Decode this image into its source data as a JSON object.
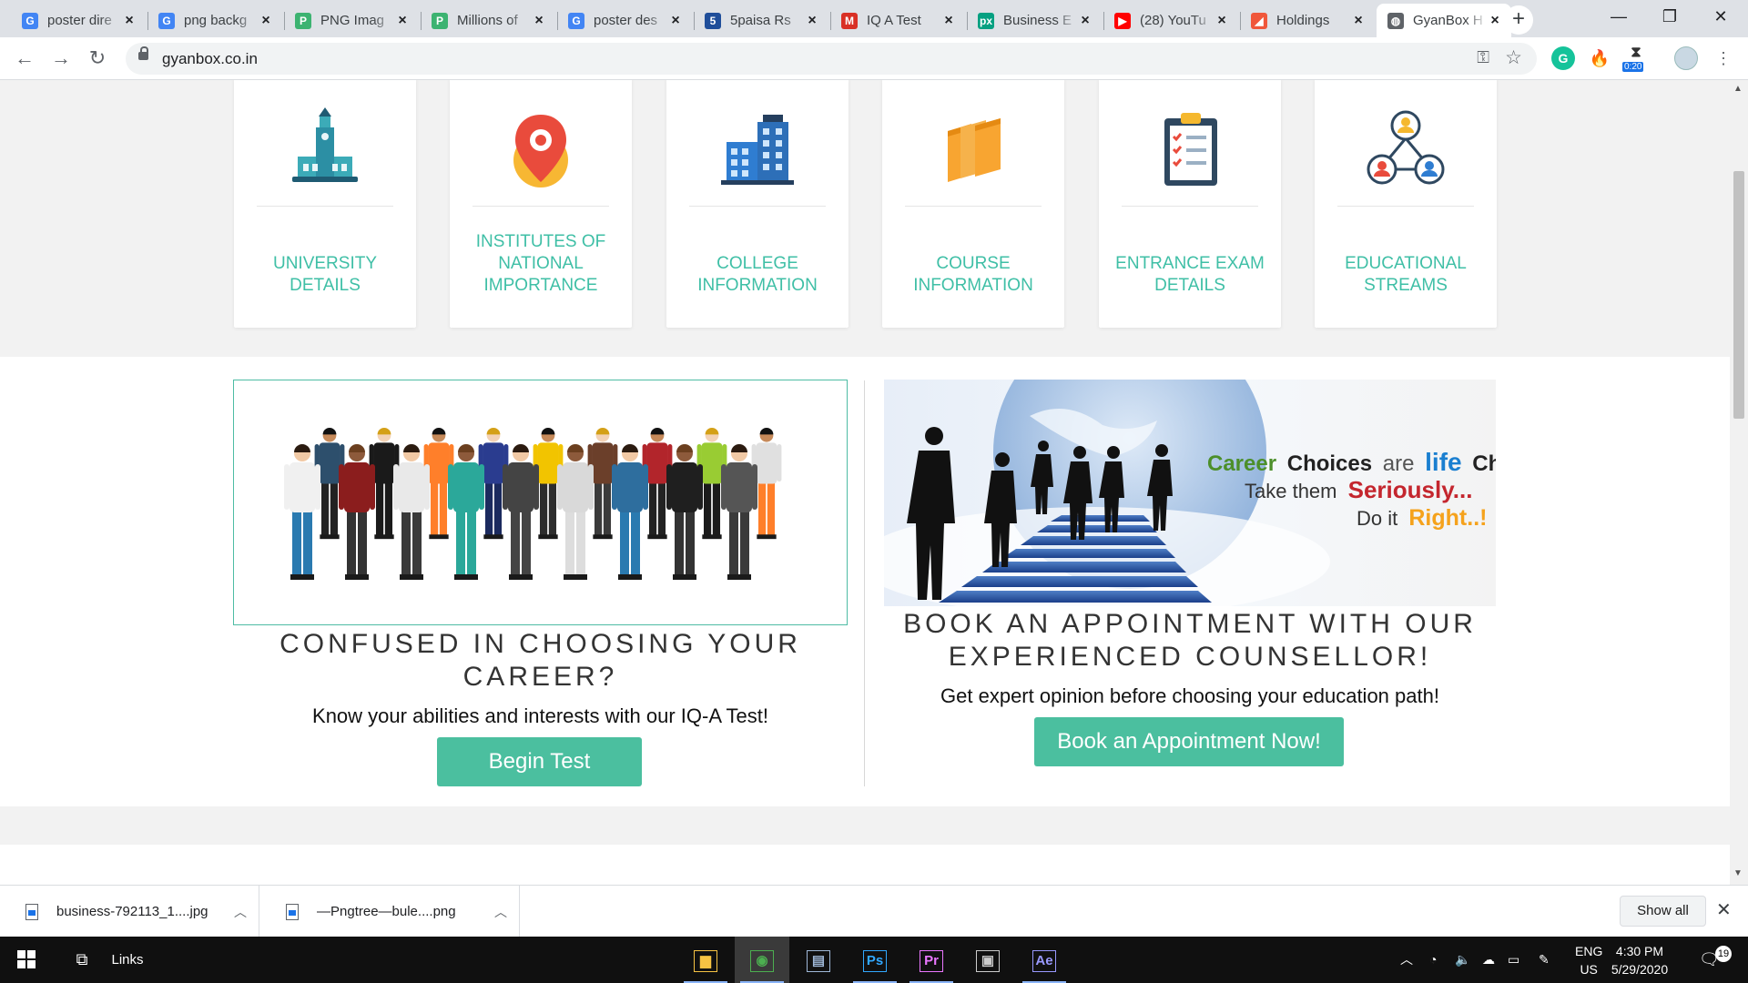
{
  "browser": {
    "tabs": [
      {
        "title": "poster dire",
        "favicon": "google-icon",
        "color": "#4285f4",
        "glyph": "G"
      },
      {
        "title": "png backg",
        "favicon": "google-icon",
        "color": "#4285f4",
        "glyph": "G"
      },
      {
        "title": "PNG Imag",
        "favicon": "pngtree-icon",
        "color": "#3cb371",
        "glyph": "P"
      },
      {
        "title": "Millions of",
        "favicon": "pngtree-icon",
        "color": "#3cb371",
        "glyph": "P"
      },
      {
        "title": "poster des",
        "favicon": "google-icon",
        "color": "#4285f4",
        "glyph": "G"
      },
      {
        "title": "5paisa Rs",
        "favicon": "5paisa-icon",
        "color": "#1f4e9a",
        "glyph": "5"
      },
      {
        "title": "IQ A Test",
        "favicon": "gmail-icon",
        "color": "#d93025",
        "glyph": "M"
      },
      {
        "title": "Business E",
        "favicon": "pexels-icon",
        "color": "#05a081",
        "glyph": "px"
      },
      {
        "title": "(28) YouTu",
        "favicon": "youtube-icon",
        "color": "#ff0000",
        "glyph": "▶"
      },
      {
        "title": "Holdings",
        "favicon": "zerodha-icon",
        "color": "#f0573b",
        "glyph": "◢"
      },
      {
        "title": "GyanBox H",
        "favicon": "globe-icon",
        "color": "#5f6368",
        "glyph": "◍",
        "active": true
      }
    ],
    "url": "gyanbox.co.in",
    "extension_badge": "0:20"
  },
  "categories": [
    {
      "label": "UNIVERSITY DETAILS",
      "icon": "university-building-icon"
    },
    {
      "label": "INSTITUTES OF NATIONAL IMPORTANCE",
      "icon": "location-pin-icon"
    },
    {
      "label": "COLLEGE INFORMATION",
      "icon": "college-building-icon"
    },
    {
      "label": "COURSE INFORMATION",
      "icon": "books-icon"
    },
    {
      "label": "ENTRANCE EXAM DETAILS",
      "icon": "clipboard-checklist-icon"
    },
    {
      "label": "EDUCATIONAL STREAMS",
      "icon": "network-people-icon"
    }
  ],
  "career_test": {
    "heading": "CONFUSED IN CHOOSING YOUR CAREER?",
    "subtext": "Know your abilities and interests with our IQ-A Test!",
    "button": "Begin Test"
  },
  "appointment": {
    "banner_line1_a": "Career",
    "banner_line1_b": "Choices",
    "banner_line1_c": "are",
    "banner_line1_d": "life",
    "banner_line1_e": "Choices",
    "banner_line2_a": "Take them",
    "banner_line2_b": "Seriously...",
    "banner_line3_a": "Do it",
    "banner_line3_b": "Right..!",
    "heading": "BOOK AN APPOINTMENT WITH OUR EXPERIENCED COUNSELLOR!",
    "subtext": "Get expert opinion before choosing your education path!",
    "button": "Book an Appointment Now!"
  },
  "downloads": {
    "items": [
      {
        "name": "business-792113_1....jpg"
      },
      {
        "name": "—Pngtree—bule....png"
      }
    ],
    "show_all": "Show all"
  },
  "taskbar": {
    "links_label": "Links",
    "apps": [
      {
        "name": "file-explorer-icon",
        "glyph": "▆"
      },
      {
        "name": "chrome-icon",
        "glyph": "◉"
      },
      {
        "name": "files-icon",
        "glyph": "▤"
      },
      {
        "name": "photoshop-icon",
        "glyph": "Ps"
      },
      {
        "name": "premiere-icon",
        "glyph": "Pr"
      },
      {
        "name": "app-icon",
        "glyph": "▣"
      },
      {
        "name": "after-effects-icon",
        "glyph": "Ae"
      }
    ],
    "lang_line1": "ENG",
    "lang_line2": "US",
    "time": "4:30 PM",
    "date": "5/29/2020",
    "notifications": "19"
  }
}
